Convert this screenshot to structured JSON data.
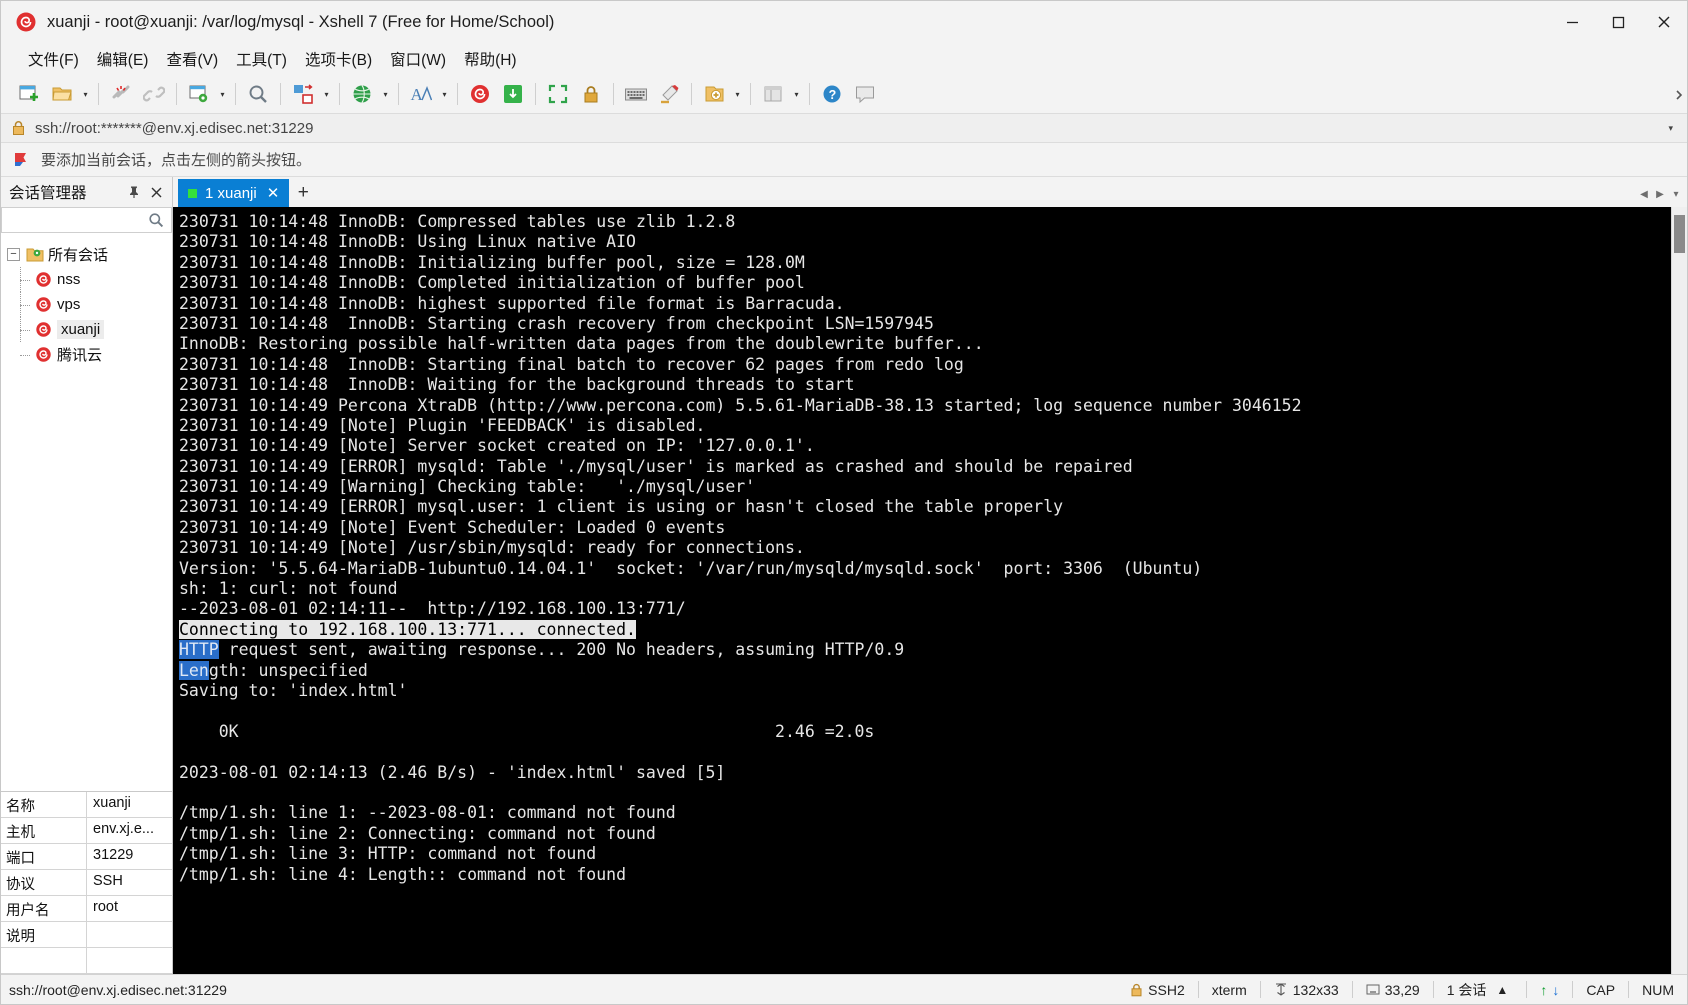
{
  "window": {
    "title": "xuanji - root@xuanji: /var/log/mysql - Xshell 7 (Free for Home/School)",
    "app_icon": "xshell-spiral-icon",
    "minimize": "─",
    "maximize": "☐",
    "close": "✕"
  },
  "menu": {
    "items": [
      {
        "label": "文件(F)",
        "name": "menu-file"
      },
      {
        "label": "编辑(E)",
        "name": "menu-edit"
      },
      {
        "label": "查看(V)",
        "name": "menu-view"
      },
      {
        "label": "工具(T)",
        "name": "menu-tools"
      },
      {
        "label": "选项卡(B)",
        "name": "menu-tabs"
      },
      {
        "label": "窗口(W)",
        "name": "menu-window"
      },
      {
        "label": "帮助(H)",
        "name": "menu-help"
      }
    ]
  },
  "toolbar": {
    "caret": "▾",
    "icons": [
      "new-session-icon",
      "open-folder-icon",
      "disconnect-icon",
      "connect-link-icon",
      "session-properties-icon",
      "find-icon",
      "transfer-icon",
      "globe-icon",
      "font-icon",
      "xshell-icon",
      "xftp-icon",
      "fullscreen-icon",
      "lock-icon",
      "keyboard-icon",
      "highlight-icon",
      "add-note-icon",
      "layout-icon",
      "help-icon",
      "comment-icon"
    ]
  },
  "address_bar": {
    "lock_icon": "lock-icon",
    "url": "ssh://root:*******@env.xj.edisec.net:31229",
    "caret": "▾"
  },
  "notice_bar": {
    "flag_icon": "red-flag-icon",
    "text": "要添加当前会话，点击左侧的箭头按钮。"
  },
  "sidebar": {
    "title": "会话管理器",
    "pin_icon": "pin-icon",
    "close_icon": "close-icon",
    "search_icon": "search-icon",
    "tree": {
      "root": {
        "label": "所有会话",
        "icon": "folder-gear-icon",
        "expander": "−"
      },
      "children": [
        {
          "label": "nss",
          "icon": "session-icon",
          "selected": false
        },
        {
          "label": "vps",
          "icon": "session-icon",
          "selected": false
        },
        {
          "label": "xuanji",
          "icon": "session-icon",
          "selected": true
        },
        {
          "label": "腾讯云",
          "icon": "session-icon",
          "selected": false
        }
      ]
    },
    "properties": [
      {
        "key": "名称",
        "value": "xuanji"
      },
      {
        "key": "主机",
        "value": "env.xj.e..."
      },
      {
        "key": "端口",
        "value": "31229"
      },
      {
        "key": "协议",
        "value": "SSH"
      },
      {
        "key": "用户名",
        "value": "root"
      },
      {
        "key": "说明",
        "value": ""
      },
      {
        "key": "",
        "value": ""
      }
    ]
  },
  "tabs": {
    "items": [
      {
        "label": "1 xuanji",
        "active": true,
        "status_dot": "green",
        "close": "✕"
      }
    ],
    "add_label": "+",
    "scroll_left": "◀",
    "scroll_right": "▶",
    "menu_caret": "▾"
  },
  "terminal": {
    "lines": [
      {
        "text": "230731 10:14:48 InnoDB: Compressed tables use zlib 1.2.8",
        "sel": "none"
      },
      {
        "text": "230731 10:14:48 InnoDB: Using Linux native AIO",
        "sel": "none"
      },
      {
        "text": "230731 10:14:48 InnoDB: Initializing buffer pool, size = 128.0M",
        "sel": "none"
      },
      {
        "text": "230731 10:14:48 InnoDB: Completed initialization of buffer pool",
        "sel": "none"
      },
      {
        "text": "230731 10:14:48 InnoDB: highest supported file format is Barracuda.",
        "sel": "none"
      },
      {
        "text": "230731 10:14:48  InnoDB: Starting crash recovery from checkpoint LSN=1597945",
        "sel": "none"
      },
      {
        "text": "InnoDB: Restoring possible half-written data pages from the doublewrite buffer...",
        "sel": "none"
      },
      {
        "text": "230731 10:14:48  InnoDB: Starting final batch to recover 62 pages from redo log",
        "sel": "none"
      },
      {
        "text": "230731 10:14:48  InnoDB: Waiting for the background threads to start",
        "sel": "none"
      },
      {
        "text": "230731 10:14:49 Percona XtraDB (http://www.percona.com) 5.5.61-MariaDB-38.13 started; log sequence number 3046152",
        "sel": "none"
      },
      {
        "text": "230731 10:14:49 [Note] Plugin 'FEEDBACK' is disabled.",
        "sel": "none"
      },
      {
        "text": "230731 10:14:49 [Note] Server socket created on IP: '127.0.0.1'.",
        "sel": "none"
      },
      {
        "text": "230731 10:14:49 [ERROR] mysqld: Table './mysql/user' is marked as crashed and should be repaired",
        "sel": "none"
      },
      {
        "text": "230731 10:14:49 [Warning] Checking table:   './mysql/user'",
        "sel": "none"
      },
      {
        "text": "230731 10:14:49 [ERROR] mysql.user: 1 client is using or hasn't closed the table properly",
        "sel": "none"
      },
      {
        "text": "230731 10:14:49 [Note] Event Scheduler: Loaded 0 events",
        "sel": "none"
      },
      {
        "text": "230731 10:14:49 [Note] /usr/sbin/mysqld: ready for connections.",
        "sel": "none"
      },
      {
        "text": "Version: '5.5.64-MariaDB-1ubuntu0.14.04.1'  socket: '/var/run/mysqld/mysqld.sock'  port: 3306  (Ubuntu)",
        "sel": "none"
      },
      {
        "text": "sh: 1: curl: not found",
        "sel": "none"
      },
      {
        "text": "--2023-08-01 02:14:11--  http://192.168.100.13:771/",
        "sel": "none"
      },
      {
        "text": "Connecting to 192.168.100.13:771... connected.",
        "sel": "full"
      },
      {
        "text": "HTTP request sent, awaiting response... 200 No headers, assuming HTTP/0.9",
        "sel": "blue",
        "sel_len": 4
      },
      {
        "text": "Length: unspecified",
        "sel": "blue",
        "sel_len": 3
      },
      {
        "text": "Saving to: 'index.html'",
        "sel": "none"
      },
      {
        "text": "",
        "sel": "none"
      },
      {
        "text": "    0K                                                      2.46 =2.0s",
        "sel": "none"
      },
      {
        "text": "",
        "sel": "none"
      },
      {
        "text": "2023-08-01 02:14:13 (2.46 B/s) - 'index.html' saved [5]",
        "sel": "none"
      },
      {
        "text": "",
        "sel": "none"
      },
      {
        "text": "/tmp/1.sh: line 1: --2023-08-01: command not found",
        "sel": "none"
      },
      {
        "text": "/tmp/1.sh: line 2: Connecting: command not found",
        "sel": "none"
      },
      {
        "text": "/tmp/1.sh: line 3: HTTP: command not found",
        "sel": "none"
      },
      {
        "text": "/tmp/1.sh: line 4: Length:: command not found",
        "sel": "none"
      }
    ]
  },
  "status_bar": {
    "connection": "ssh://root@env.xj.edisec.net:31229",
    "lock_icon": "lock-icon",
    "protocol": "SSH2",
    "terminal_type": "xterm",
    "size_icon": "resize-icon",
    "size": "132x33",
    "cursor_icon": "cursor-icon",
    "cursor": "33,29",
    "sessions": "1 会话",
    "sessions_caret": "▲",
    "upload_arrow": "↑",
    "download_arrow": "↓",
    "cap": "CAP",
    "num": "NUM"
  },
  "colors": {
    "accent": "#0a7fd4",
    "terminal_bg": "#000000",
    "terminal_fg": "#e6e6e6",
    "selection_bg": "#e8e8e8",
    "selection_blue": "#2a6ec9",
    "chrome_bg": "#f3f3f3"
  }
}
